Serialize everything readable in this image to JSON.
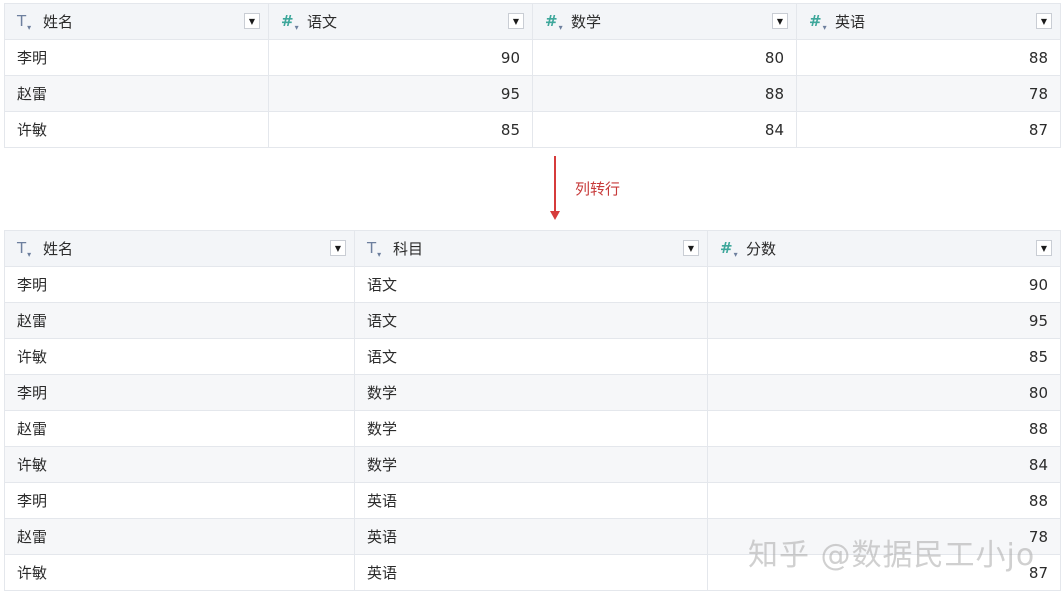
{
  "top_table": {
    "columns": [
      {
        "label": "姓名",
        "type": "text",
        "icon": "text-type-icon"
      },
      {
        "label": "语文",
        "type": "number",
        "icon": "number-type-icon"
      },
      {
        "label": "数学",
        "type": "number",
        "icon": "number-type-icon"
      },
      {
        "label": "英语",
        "type": "number",
        "icon": "number-type-icon"
      }
    ],
    "rows": [
      [
        "李明",
        "90",
        "80",
        "88"
      ],
      [
        "赵雷",
        "95",
        "88",
        "78"
      ],
      [
        "许敏",
        "85",
        "84",
        "87"
      ]
    ]
  },
  "transform": {
    "label": "列转行",
    "color": "#d63b3b"
  },
  "bottom_table": {
    "columns": [
      {
        "label": "姓名",
        "type": "text",
        "icon": "text-type-icon"
      },
      {
        "label": "科目",
        "type": "text",
        "icon": "text-type-icon"
      },
      {
        "label": "分数",
        "type": "number",
        "icon": "number-type-icon"
      }
    ],
    "rows": [
      [
        "李明",
        "语文",
        "90"
      ],
      [
        "赵雷",
        "语文",
        "95"
      ],
      [
        "许敏",
        "语文",
        "85"
      ],
      [
        "李明",
        "数学",
        "80"
      ],
      [
        "赵雷",
        "数学",
        "88"
      ],
      [
        "许敏",
        "数学",
        "84"
      ],
      [
        "李明",
        "英语",
        "88"
      ],
      [
        "赵雷",
        "英语",
        "78"
      ],
      [
        "许敏",
        "英语",
        "87"
      ]
    ]
  },
  "icons": {
    "text_glyph": "T",
    "number_glyph": "#",
    "caret_glyph": "▾",
    "dropdown_glyph": "▼"
  },
  "watermark": "知乎 @数据民工小jo"
}
